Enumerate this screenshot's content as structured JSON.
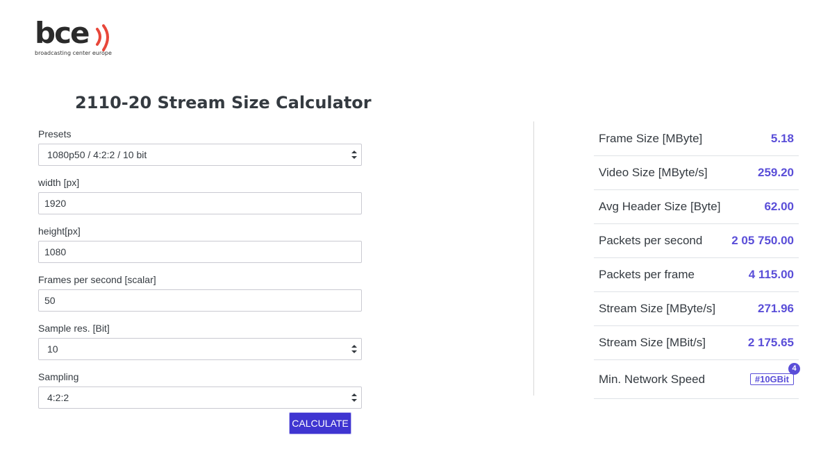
{
  "logo": {
    "text": "bce",
    "subtitle": "broadcasting center europe",
    "wave_color": "#e8473a"
  },
  "title": "2110-20 Stream Size Calculator",
  "form": {
    "presets": {
      "label": "Presets",
      "value": "1080p50 / 4:2:2 / 10 bit"
    },
    "width": {
      "label": "width [px]",
      "value": "1920"
    },
    "height": {
      "label": "height[px]",
      "value": "1080"
    },
    "fps": {
      "label": "Frames per second [scalar]",
      "value": "50"
    },
    "sample_res": {
      "label": "Sample res. [Bit]",
      "value": "10"
    },
    "sampling": {
      "label": "Sampling",
      "value": "4:2:2"
    },
    "calculate_label": "CALCULATE"
  },
  "results": [
    {
      "label": "Frame Size [MByte]",
      "value": "5.18"
    },
    {
      "label": "Video Size [MByte/s]",
      "value": "259.20"
    },
    {
      "label": "Avg Header Size [Byte]",
      "value": "62.00"
    },
    {
      "label": "Packets per second",
      "value": "2 05 750.00"
    },
    {
      "label": "Packets per frame",
      "value": "4 115.00"
    },
    {
      "label": "Stream Size [MByte/s]",
      "value": "271.96"
    },
    {
      "label": "Stream Size [MBit/s]",
      "value": "2 175.65"
    }
  ],
  "network": {
    "label": "Min. Network Speed",
    "badge": "#10GBit",
    "count": "4"
  },
  "colors": {
    "accent": "#5a4ed8",
    "button": "#3f35d1",
    "text": "#343a40"
  }
}
